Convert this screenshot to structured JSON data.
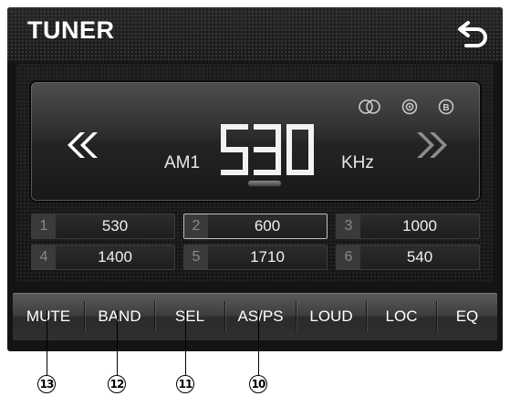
{
  "header": {
    "title": "TUNER",
    "back_icon": "back-arrow-icon"
  },
  "display": {
    "status_icons": [
      "stereo-icon",
      "radio-icon",
      "b-circle-icon"
    ],
    "band": "AM1",
    "frequency": "530",
    "unit": "KHz",
    "seek_left_icon": "seek-back-icon",
    "seek_right_icon": "seek-forward-icon"
  },
  "presets": [
    {
      "num": "1",
      "value": "530"
    },
    {
      "num": "2",
      "value": "600",
      "selected": true
    },
    {
      "num": "3",
      "value": "1000"
    },
    {
      "num": "4",
      "value": "1400"
    },
    {
      "num": "5",
      "value": "1710"
    },
    {
      "num": "6",
      "value": "540"
    }
  ],
  "toolbar": {
    "mute": "MUTE",
    "band": "BAND",
    "sel": "SEL",
    "asps": "AS/PS",
    "loud": "LOUD",
    "loc": "LOC",
    "eq": "EQ"
  },
  "callouts": {
    "c13": "13",
    "c12": "12",
    "c11": "11",
    "c10": "10"
  },
  "colors": {
    "screen_bg": "#141414",
    "text": "#ffffff",
    "selected_border": "#bdbdbd"
  }
}
